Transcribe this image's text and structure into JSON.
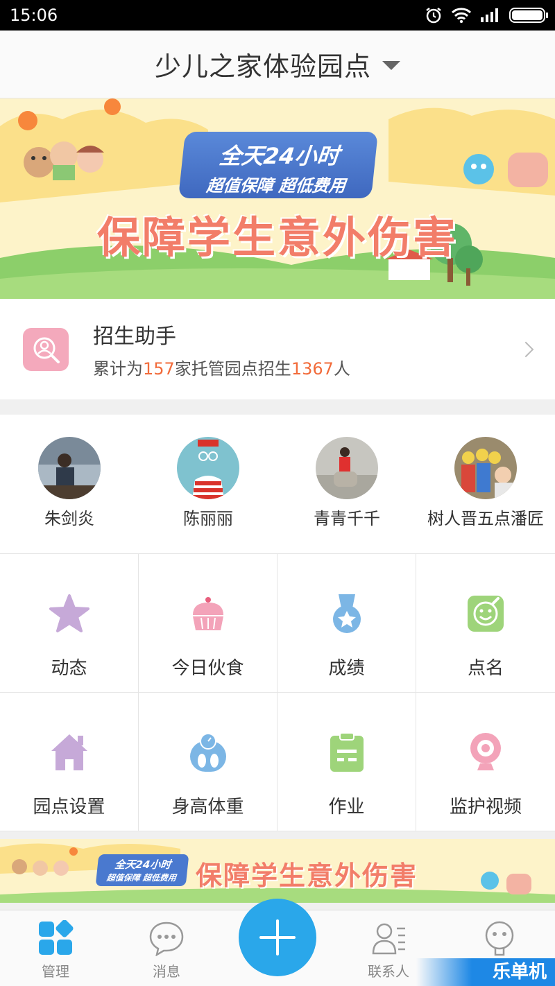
{
  "status_bar": {
    "time": "15:06"
  },
  "header": {
    "title": "少儿之家体验园点"
  },
  "banner": {
    "line1": "全天24小时",
    "line2": "超值保障 超低费用",
    "main": "保障学生意外伤害"
  },
  "enroll": {
    "title": "招生助手",
    "sub_prefix": "累计为",
    "sites": "157",
    "sub_mid": "家托管园点招生",
    "students": "1367",
    "sub_suffix": "人"
  },
  "contacts": [
    {
      "name": "朱剑炎"
    },
    {
      "name": "陈丽丽"
    },
    {
      "name": "青青千千"
    },
    {
      "name": "树人晋五点潘匠"
    }
  ],
  "features": [
    {
      "label": "动态",
      "icon": "star-icon",
      "color": "#c6a9d8"
    },
    {
      "label": "今日伙食",
      "icon": "cupcake-icon",
      "color": "#f3a3b9"
    },
    {
      "label": "成绩",
      "icon": "medal-icon",
      "color": "#7cb6e5"
    },
    {
      "label": "点名",
      "icon": "rollcall-icon",
      "color": "#9ed47a"
    },
    {
      "label": "园点设置",
      "icon": "house-icon",
      "color": "#c6a9d8"
    },
    {
      "label": "身高体重",
      "icon": "scale-icon",
      "color": "#7cb6e5"
    },
    {
      "label": "作业",
      "icon": "homework-icon",
      "color": "#9ed47a"
    },
    {
      "label": "监护视频",
      "icon": "webcam-icon",
      "color": "#f3a3b9"
    }
  ],
  "banner2": {
    "line1": "全天24小时",
    "line2": "超值保障 超低费用",
    "main": "保障学生意外伤害"
  },
  "tabs": [
    {
      "label": "管理",
      "icon": "grid-icon"
    },
    {
      "label": "消息",
      "icon": "chat-icon"
    },
    {
      "label": "联系人",
      "icon": "contacts-icon"
    },
    {
      "label": "",
      "icon": "robot-icon"
    }
  ],
  "watermark": "乐单机",
  "colors": {
    "accent": "#2aa7ea",
    "highlight": "#f26b3a",
    "banner_text": "#f27d69"
  }
}
